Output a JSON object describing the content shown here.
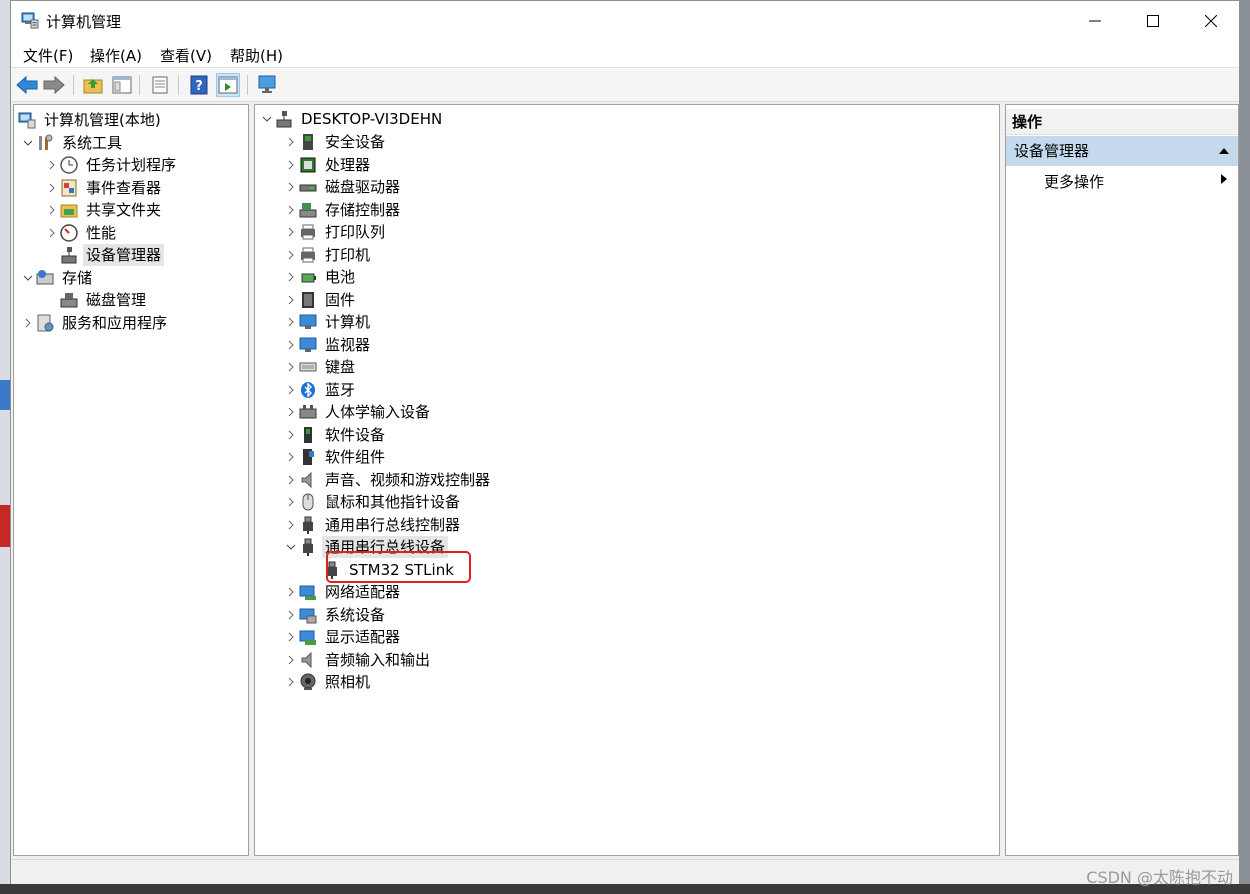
{
  "window": {
    "title": "计算机管理",
    "controls": {
      "minimize": "—",
      "maximize": "☐",
      "close": "✕"
    }
  },
  "menu": [
    "文件(F)",
    "操作(A)",
    "查看(V)",
    "帮助(H)"
  ],
  "left_tree": [
    {
      "label": "计算机管理(本地)",
      "icon": "computer-management-icon",
      "level": 0,
      "expander": ""
    },
    {
      "label": "系统工具",
      "icon": "tools-icon",
      "level": 1,
      "expander": "expanded"
    },
    {
      "label": "任务计划程序",
      "icon": "clock-icon",
      "level": 2,
      "expander": "collapsed"
    },
    {
      "label": "事件查看器",
      "icon": "event-viewer-icon",
      "level": 2,
      "expander": "collapsed"
    },
    {
      "label": "共享文件夹",
      "icon": "shared-folder-icon",
      "level": 2,
      "expander": "collapsed"
    },
    {
      "label": "性能",
      "icon": "performance-icon",
      "level": 2,
      "expander": "collapsed"
    },
    {
      "label": "设备管理器",
      "icon": "device-manager-icon",
      "level": 2,
      "expander": "",
      "selected": true
    },
    {
      "label": "存储",
      "icon": "storage-icon",
      "level": 1,
      "expander": "expanded"
    },
    {
      "label": "磁盘管理",
      "icon": "disk-management-icon",
      "level": 2,
      "expander": ""
    },
    {
      "label": "服务和应用程序",
      "icon": "services-icon",
      "level": 1,
      "expander": "collapsed"
    }
  ],
  "device_tree": {
    "root": "DESKTOP-VI3DEHN",
    "categories": [
      {
        "label": "安全设备",
        "icon": "security-device-icon",
        "expander": "collapsed"
      },
      {
        "label": "处理器",
        "icon": "processor-icon",
        "expander": "collapsed"
      },
      {
        "label": "磁盘驱动器",
        "icon": "disk-drive-icon",
        "expander": "collapsed"
      },
      {
        "label": "存储控制器",
        "icon": "storage-controller-icon",
        "expander": "collapsed"
      },
      {
        "label": "打印队列",
        "icon": "print-queue-icon",
        "expander": "collapsed"
      },
      {
        "label": "打印机",
        "icon": "printer-icon",
        "expander": "collapsed"
      },
      {
        "label": "电池",
        "icon": "battery-icon",
        "expander": "collapsed"
      },
      {
        "label": "固件",
        "icon": "firmware-icon",
        "expander": "collapsed"
      },
      {
        "label": "计算机",
        "icon": "computer-icon",
        "expander": "collapsed"
      },
      {
        "label": "监视器",
        "icon": "monitor-icon",
        "expander": "collapsed"
      },
      {
        "label": "键盘",
        "icon": "keyboard-icon",
        "expander": "collapsed"
      },
      {
        "label": "蓝牙",
        "icon": "bluetooth-icon",
        "expander": "collapsed"
      },
      {
        "label": "人体学输入设备",
        "icon": "hid-icon",
        "expander": "collapsed"
      },
      {
        "label": "软件设备",
        "icon": "software-device-icon",
        "expander": "collapsed"
      },
      {
        "label": "软件组件",
        "icon": "software-component-icon",
        "expander": "collapsed"
      },
      {
        "label": "声音、视频和游戏控制器",
        "icon": "speaker-icon",
        "expander": "collapsed"
      },
      {
        "label": "鼠标和其他指针设备",
        "icon": "mouse-icon",
        "expander": "collapsed"
      },
      {
        "label": "通用串行总线控制器",
        "icon": "usb-icon",
        "expander": "collapsed"
      },
      {
        "label": "通用串行总线设备",
        "icon": "usb-icon",
        "expander": "expanded",
        "selected": true,
        "children": [
          {
            "label": "STM32 STLink",
            "icon": "usb-device-icon"
          }
        ]
      },
      {
        "label": "网络适配器",
        "icon": "network-adapter-icon",
        "expander": "collapsed"
      },
      {
        "label": "系统设备",
        "icon": "system-device-icon",
        "expander": "collapsed"
      },
      {
        "label": "显示适配器",
        "icon": "display-adapter-icon",
        "expander": "collapsed"
      },
      {
        "label": "音频输入和输出",
        "icon": "audio-icon",
        "expander": "collapsed"
      },
      {
        "label": "照相机",
        "icon": "camera-icon",
        "expander": "collapsed"
      }
    ]
  },
  "actions": {
    "header": "操作",
    "section": "设备管理器",
    "item": "更多操作"
  },
  "watermark": "CSDN @太陈抱不动",
  "colors": {
    "selection": "#cce8ff",
    "actions_section": "#c5d9ee",
    "highlight": "#e02020"
  }
}
